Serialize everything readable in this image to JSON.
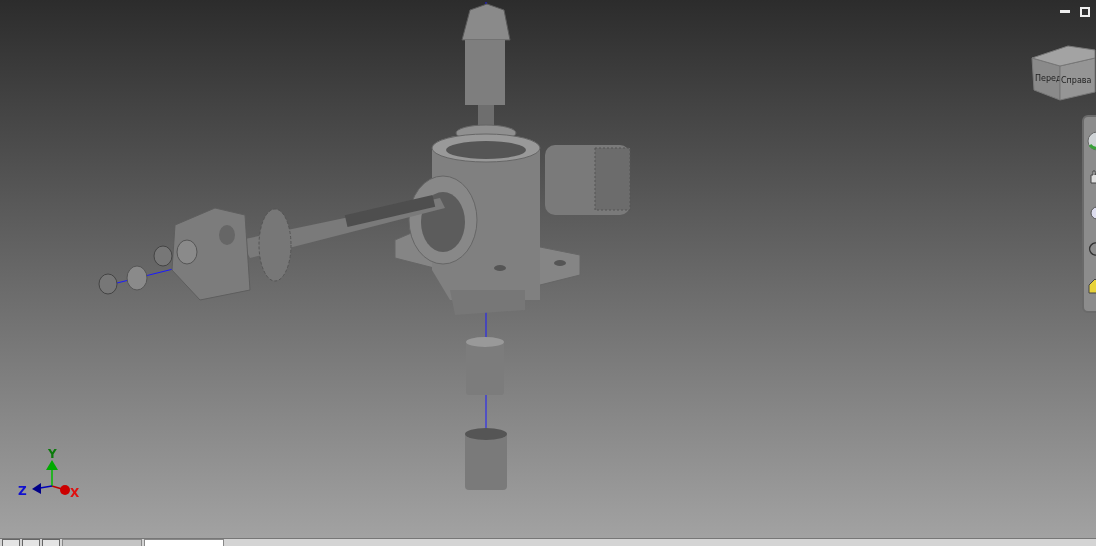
{
  "window_controls": [
    {
      "kind": "minimize"
    },
    {
      "kind": "restore"
    }
  ],
  "view_cube": {
    "faces": [
      "Перед",
      "Справа"
    ]
  },
  "navigation_bar": {
    "tools": [
      {
        "kind": "wheel"
      },
      {
        "kind": "pan"
      },
      {
        "kind": "zoom"
      },
      {
        "kind": "orbit"
      },
      {
        "kind": "look"
      }
    ]
  },
  "axis_triad": {
    "labels": [
      {
        "kind": "x",
        "text": "X"
      },
      {
        "kind": "y",
        "text": "Y"
      },
      {
        "kind": "z",
        "text": "Z"
      }
    ]
  },
  "document_tabs": [
    {
      "selected": false
    },
    {
      "selected": true
    }
  ]
}
